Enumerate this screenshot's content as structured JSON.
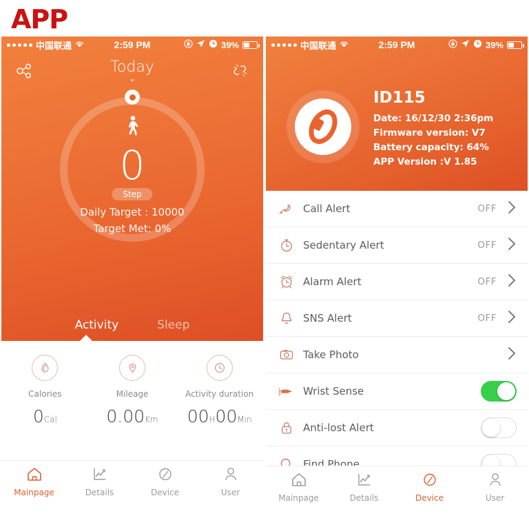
{
  "page": {
    "title": "APP",
    "title_color": "#cc1111"
  },
  "status_bar": {
    "carrier": "中国联通",
    "signal_dots": 5,
    "wifi_icon": "wifi-icon",
    "time": "2:59 PM",
    "rotation_lock_icon": "rotation-lock-icon",
    "location_icon": "location-arrow-icon",
    "alarm_icon": "alarm-clock-icon",
    "battery_percent": "39%"
  },
  "left_phone": {
    "navbar": {
      "share_icon": "share-icon",
      "title": "Today",
      "caret": "⌄",
      "unlink_icon": "broken-link-icon"
    },
    "ring": {
      "walk_icon": "walking-person-icon",
      "steps": "0",
      "unit_pill": "Step",
      "daily_target": "Daily Target : 10000",
      "target_met": "Target Met: 0%",
      "progress_percent": 0
    },
    "tabs": [
      {
        "label": "Activity",
        "active": true
      },
      {
        "label": "Sleep",
        "active": false
      }
    ],
    "stats": [
      {
        "icon": "flame-icon",
        "label": "Calories",
        "value": "0",
        "unit": "Cal"
      },
      {
        "icon": "pin-icon",
        "label": "Mileage",
        "value": "0.00",
        "unit": "Km"
      },
      {
        "icon": "clock-icon",
        "label": "Activity duration",
        "value": "00",
        "unit": "H",
        "value2": "00",
        "unit2": "Min"
      }
    ],
    "tabbar": [
      {
        "icon": "home-icon",
        "label": "Mainpage",
        "active": true
      },
      {
        "icon": "chart-icon",
        "label": "Details",
        "active": false
      },
      {
        "icon": "compass-icon",
        "label": "Device",
        "active": false
      },
      {
        "icon": "user-icon",
        "label": "User",
        "active": false
      }
    ]
  },
  "right_phone": {
    "device": {
      "badge_icon": "fitness-band-icon",
      "name": "ID115",
      "date": "Date: 16/12/30 2:36pm",
      "firmware": "Firmware version: V7",
      "battery": "Battery capacity: 64%",
      "app_version": "APP Version :V 1.85"
    },
    "settings": [
      {
        "icon": "phone-call-icon",
        "label": "Call Alert",
        "value": "OFF",
        "control": "chevron"
      },
      {
        "icon": "stopwatch-icon",
        "label": "Sedentary Alert",
        "value": "OFF",
        "control": "chevron"
      },
      {
        "icon": "alarm-clock-icon",
        "label": "Alarm Alert",
        "value": "OFF",
        "control": "chevron"
      },
      {
        "icon": "bell-icon",
        "label": "SNS Alert",
        "value": "OFF",
        "control": "chevron"
      },
      {
        "icon": "camera-icon",
        "label": "Take Photo",
        "value": "",
        "control": "chevron"
      },
      {
        "icon": "wrist-hand-icon",
        "label": "Wrist Sense",
        "value": "",
        "control": "toggle",
        "on": true
      },
      {
        "icon": "lock-icon",
        "label": "Anti-lost Alert",
        "value": "",
        "control": "toggle",
        "on": false
      },
      {
        "icon": "search-icon",
        "label": "Find Phone",
        "value": "",
        "control": "toggle",
        "on": false
      }
    ],
    "tabbar": [
      {
        "icon": "home-icon",
        "label": "Mainpage",
        "active": false
      },
      {
        "icon": "chart-icon",
        "label": "Details",
        "active": false
      },
      {
        "icon": "compass-icon",
        "label": "Device",
        "active": true
      },
      {
        "icon": "user-icon",
        "label": "User",
        "active": false
      }
    ]
  },
  "colors": {
    "accent": "#d9622e",
    "toggle_on": "#36d04b",
    "title_red": "#cc1111"
  }
}
